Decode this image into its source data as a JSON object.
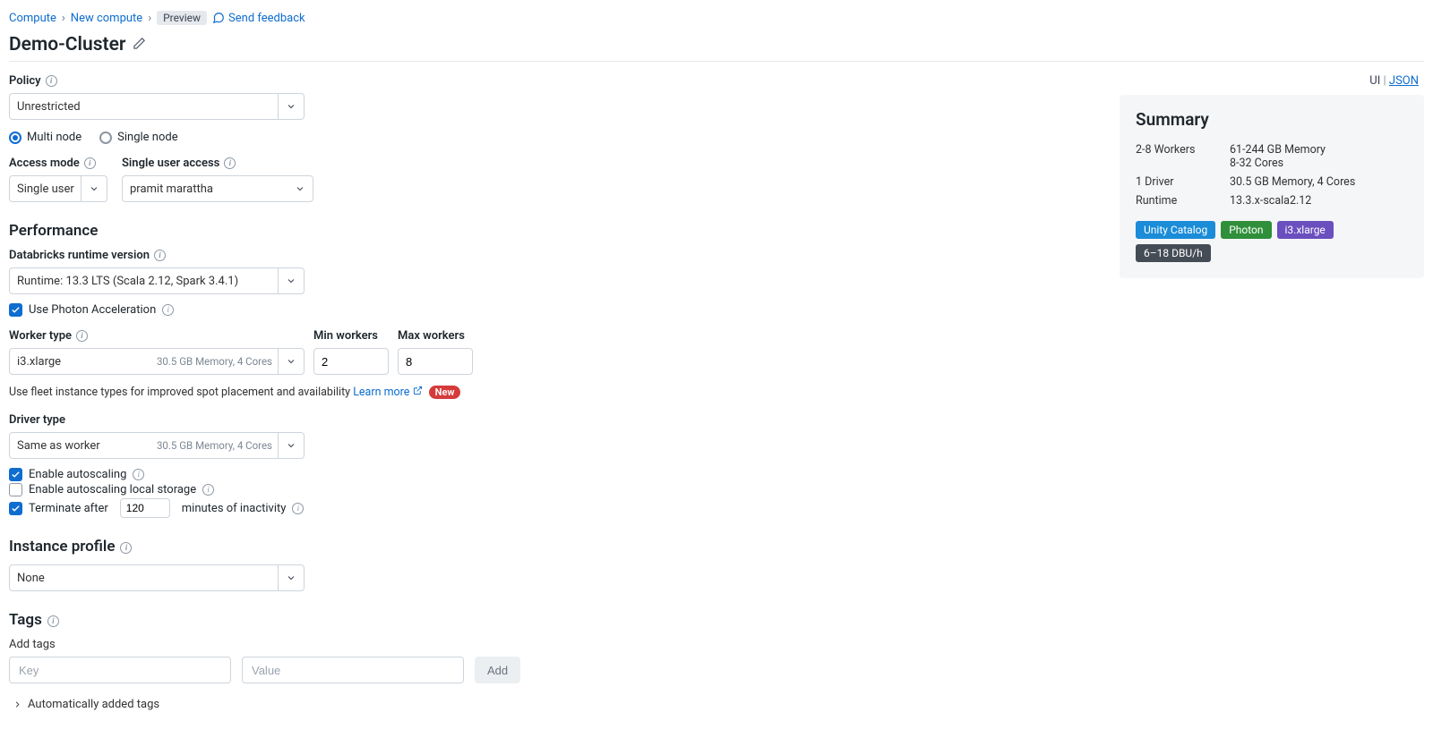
{
  "breadcrumb": {
    "compute": "Compute",
    "new": "New compute",
    "preview": "Preview",
    "feedback": "Send feedback"
  },
  "title": "Demo-Cluster",
  "top_right": {
    "ui": "UI",
    "json": "JSON"
  },
  "policy": {
    "label": "Policy",
    "value": "Unrestricted"
  },
  "node_mode": {
    "multi": "Multi node",
    "single": "Single node"
  },
  "access_mode": {
    "label": "Access mode",
    "value": "Single user"
  },
  "single_user": {
    "label": "Single user access",
    "value": "pramit marattha"
  },
  "sections": {
    "performance": "Performance",
    "instance_profile": "Instance profile",
    "tags": "Tags"
  },
  "runtime": {
    "label": "Databricks runtime version",
    "value": "Runtime: 13.3 LTS (Scala 2.12, Spark 3.4.1)"
  },
  "photon": {
    "label": "Use Photon Acceleration"
  },
  "worker": {
    "label": "Worker type",
    "value": "i3.xlarge",
    "meta": "30.5 GB Memory, 4 Cores",
    "min_label": "Min workers",
    "min_value": "2",
    "max_label": "Max workers",
    "max_value": "8"
  },
  "fleet_hint": {
    "text": "Use fleet instance types for improved spot placement and availability",
    "learn": "Learn more",
    "new": "New"
  },
  "driver": {
    "label": "Driver type",
    "value": "Same as worker",
    "meta": "30.5 GB Memory, 4 Cores"
  },
  "autoscale": {
    "label": "Enable autoscaling"
  },
  "autoscale_storage": {
    "label": "Enable autoscaling local storage"
  },
  "terminate": {
    "prefix": "Terminate after",
    "value": "120",
    "suffix": "minutes of inactivity"
  },
  "instance_profile": {
    "value": "None"
  },
  "tags": {
    "add_label": "Add tags",
    "key_ph": "Key",
    "val_ph": "Value",
    "add_btn": "Add",
    "auto": "Automatically added tags"
  },
  "summary": {
    "heading": "Summary",
    "rows": {
      "workers_k": "2-8 Workers",
      "workers_v1": "61-244 GB Memory",
      "workers_v2": "8-32 Cores",
      "driver_k": "1 Driver",
      "driver_v": "30.5 GB Memory, 4 Cores",
      "runtime_k": "Runtime",
      "runtime_v": "13.3.x-scala2.12"
    },
    "badges": {
      "uc": "Unity Catalog",
      "photon": "Photon",
      "inst": "i3.xlarge",
      "dbu": "6–18 DBU/h"
    }
  }
}
